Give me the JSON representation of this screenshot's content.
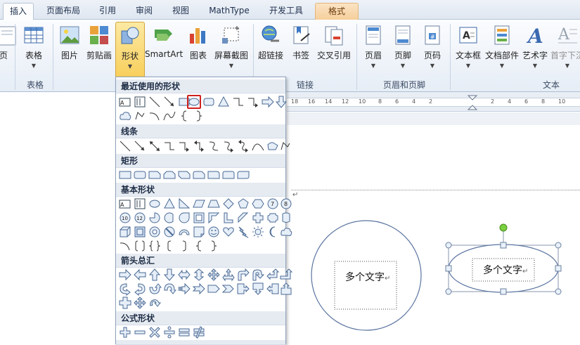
{
  "tabs": [
    "插入",
    "页面布局",
    "引用",
    "审阅",
    "视图",
    "MathType",
    "开发工具",
    "格式"
  ],
  "ribbon": {
    "buttons": {
      "page_left": "页",
      "table": "表格",
      "picture": "图片",
      "clipart": "剪贴画",
      "shapes": "形状",
      "smartart": "SmartArt",
      "chart": "图表",
      "screenshot": "屏幕截图",
      "hyperlink": "超链接",
      "bookmark": "书签",
      "crossref": "交叉引用",
      "header": "页眉",
      "footer": "页脚",
      "pagenum": "页码",
      "textbox": "文本框",
      "quickparts": "文档部件",
      "wordart": "艺术字",
      "dropcap": "首字下沉"
    },
    "groups": {
      "table": "表格",
      "links": "链接",
      "headerfooter": "页眉和页脚",
      "text": "文本"
    }
  },
  "ruler": {
    "numbers": [
      "18",
      "16",
      "14",
      "12",
      "10",
      "8",
      "6",
      "4",
      "2",
      "2",
      "4",
      "6",
      "8",
      "10"
    ]
  },
  "gallery": {
    "sections": {
      "recent": "最近使用的形状",
      "lines": "线条",
      "rectangles": "矩形",
      "basic": "基本形状",
      "arrows": "箭头总汇",
      "equation": "公式形状"
    },
    "highlighted_shape": "oval"
  },
  "document": {
    "circle_text": "多个文字",
    "ellipse_text": "多个文字",
    "return_symbol": "↵"
  }
}
